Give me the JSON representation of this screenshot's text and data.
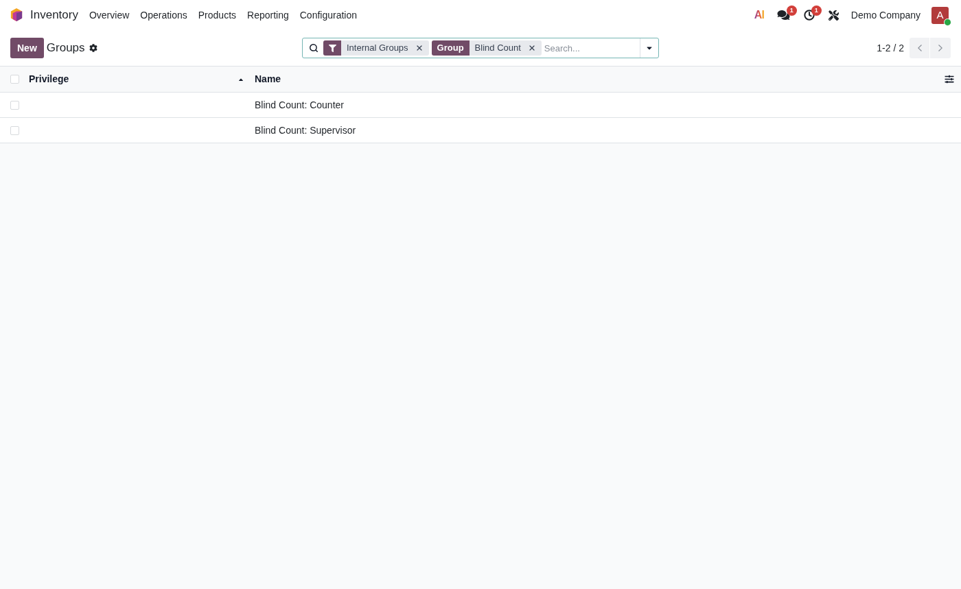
{
  "navbar": {
    "app_name": "Inventory",
    "menu": [
      "Overview",
      "Operations",
      "Products",
      "Reporting",
      "Configuration"
    ],
    "systray": [
      {
        "kind": "ai",
        "label": "AI"
      },
      {
        "kind": "messages",
        "badge": "1"
      },
      {
        "kind": "activities",
        "badge": "1"
      },
      {
        "kind": "debug"
      }
    ],
    "company": "Demo Company",
    "avatar": {
      "initial": "A",
      "online": true
    }
  },
  "control_panel": {
    "new_button": "New",
    "title": "Groups",
    "search": {
      "facets": [
        {
          "kind": "filter",
          "values": [
            "Internal Groups"
          ]
        },
        {
          "kind": "group",
          "label": "Group",
          "values": [
            "Blind Count"
          ]
        }
      ],
      "placeholder": "Search..."
    },
    "pager": "1-2 / 2"
  },
  "table": {
    "select_all": {
      "checked": false
    },
    "columns": [
      {
        "label": "Privilege",
        "sorted": true
      },
      {
        "label": "Name",
        "sorted": false
      }
    ],
    "rows": [
      {
        "selected": false,
        "name": "Blind Count: Counter"
      },
      {
        "selected": false,
        "name": "Blind Count: Supervisor"
      }
    ]
  }
}
